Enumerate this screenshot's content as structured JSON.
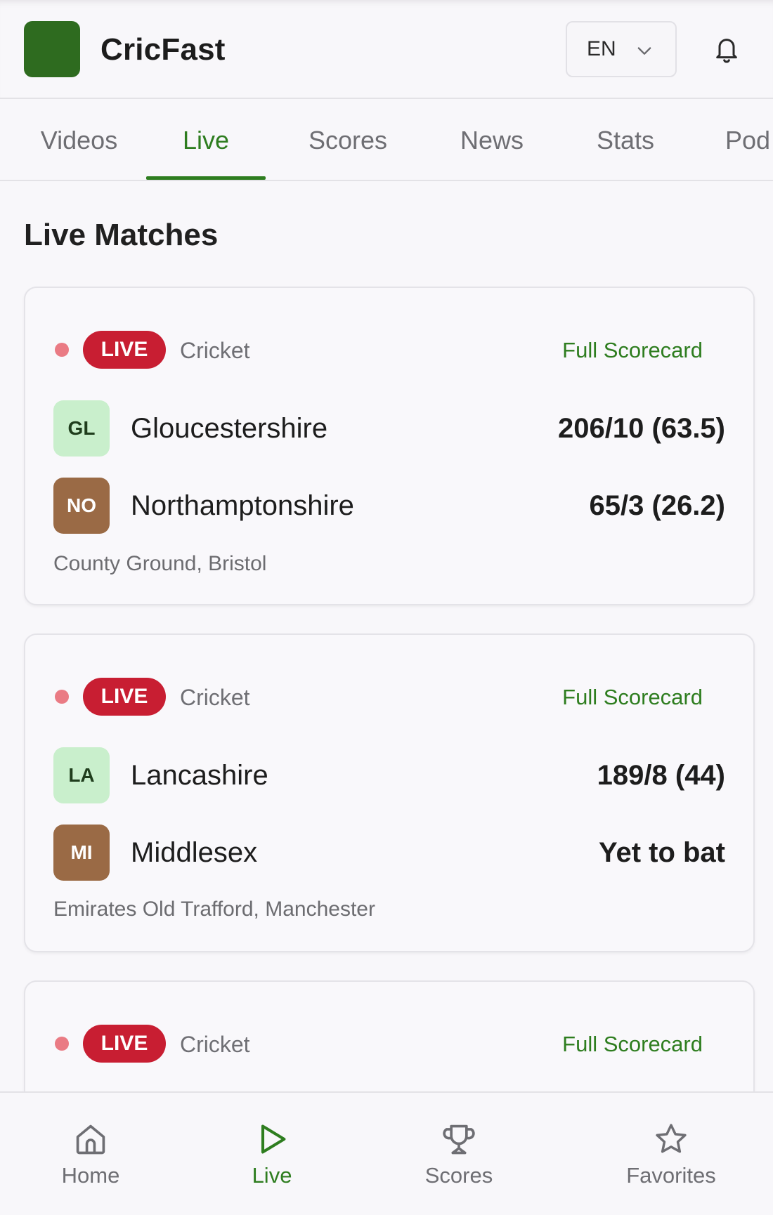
{
  "app": {
    "title": "CricFast"
  },
  "header": {
    "language": "EN",
    "icons": {
      "logo": "app-logo",
      "language_chevron": "chevron-down-icon",
      "notifications": "bell-icon"
    }
  },
  "tabs": [
    {
      "label": "Videos",
      "active": false
    },
    {
      "label": "Live",
      "active": true
    },
    {
      "label": "Scores",
      "active": false
    },
    {
      "label": "News",
      "active": false
    },
    {
      "label": "Stats",
      "active": false
    },
    {
      "label": "Pod",
      "active": false
    }
  ],
  "section": {
    "title": "Live Matches"
  },
  "matches": [
    {
      "badge": "LIVE",
      "sport": "Cricket",
      "link": "Full Scorecard",
      "team1": {
        "abbr": "GL",
        "name": "Gloucestershire",
        "score": "206/10 (63.5)"
      },
      "team2": {
        "abbr": "NO",
        "name": "Northamptonshire",
        "score": "65/3 (26.2)"
      },
      "venue": "County Ground, Bristol"
    },
    {
      "badge": "LIVE",
      "sport": "Cricket",
      "link": "Full Scorecard",
      "team1": {
        "abbr": "LA",
        "name": "Lancashire",
        "score": "189/8 (44)"
      },
      "team2": {
        "abbr": "MI",
        "name": "Middlesex",
        "score": "Yet to bat"
      },
      "venue": "Emirates Old Trafford, Manchester"
    },
    {
      "badge": "LIVE",
      "sport": "Cricket",
      "link": "Full Scorecard"
    }
  ],
  "bottom_nav": [
    {
      "label": "Home",
      "icon": "home-icon",
      "active": false
    },
    {
      "label": "Live",
      "icon": "play-icon",
      "active": true
    },
    {
      "label": "Scores",
      "icon": "trophy-icon",
      "active": false
    },
    {
      "label": "Favorites",
      "icon": "star-icon",
      "active": false
    }
  ],
  "colors": {
    "brand_green": "#2e6b1f",
    "accent_green": "#2e7d1f",
    "live_red": "#c81e32",
    "live_dot": "#ea7b84",
    "badge_light": "#c9efcc",
    "badge_brown": "#9a6a45"
  }
}
